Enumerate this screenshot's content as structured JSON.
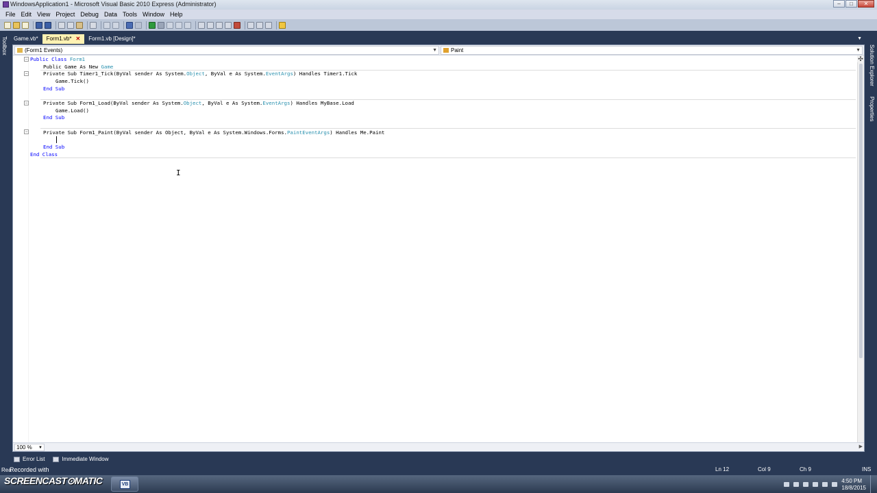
{
  "window": {
    "title": "WindowsApplication1 - Microsoft Visual Basic 2010 Express (Administrator)",
    "minimize": "–",
    "maximize": "□",
    "close": "✕"
  },
  "menubar": {
    "items": [
      "File",
      "Edit",
      "View",
      "Project",
      "Debug",
      "Data",
      "Tools",
      "Window",
      "Help"
    ]
  },
  "side_panels": {
    "left": "Toolbox",
    "right_top": "Solution Explorer",
    "right_bottom": "Properties"
  },
  "doc_tabs": {
    "items": [
      "Game.vb*",
      "Form1.vb*",
      "Form1.vb [Design]*"
    ],
    "active_index": 1,
    "close_glyph": "✕"
  },
  "navigation": {
    "class_combo": "(Form1 Events)",
    "member_combo": "Paint"
  },
  "code": {
    "l1_a": "Public Class ",
    "l1_b": "Form1",
    "l2_a": "Public Game As New ",
    "l2_b": "Game",
    "l3_a": "Private Sub Timer1_Tick(ByVal sender As System.",
    "l3_b": "Object",
    "l3_c": ", ByVal e As System.",
    "l3_d": "EventArgs",
    "l3_e": ") Handles Timer1.Tick",
    "l4": "Game.Tick()",
    "l5": "End Sub",
    "l7_a": "Private Sub Form1_Load(ByVal sender As System.",
    "l7_b": "Object",
    "l7_c": ", ByVal e As System.",
    "l7_d": "EventArgs",
    "l7_e": ") Handles MyBase.Load",
    "l8": "Game.Load()",
    "l9": "End Sub",
    "l11_a": "Private Sub Form1_Paint(ByVal sender As Object, ByVal e As System.Windows.Forms.",
    "l11_b": "PaintEventArgs",
    "l11_c": ") Handles Me.Paint",
    "l13": "End Sub",
    "l14": "End Class"
  },
  "editor_footer": {
    "zoom": "100 %"
  },
  "tool_windows": {
    "items": [
      "Error List",
      "Immediate Window"
    ]
  },
  "statusbar": {
    "left": "Rea",
    "recorded": "Recorded with",
    "ln": "Ln 12",
    "col": "Col 9",
    "ch": "Ch 9",
    "ins": "INS"
  },
  "taskbar": {
    "logo": "SCREENCAST⊙MATIC",
    "vs_glyph": "VB",
    "time": "4:50 PM",
    "date": "18/8/2015"
  },
  "colors": {
    "keyword": "#0000ff",
    "type": "#2b91af",
    "ide_background": "#293955",
    "active_tab": "#fff2b3"
  }
}
